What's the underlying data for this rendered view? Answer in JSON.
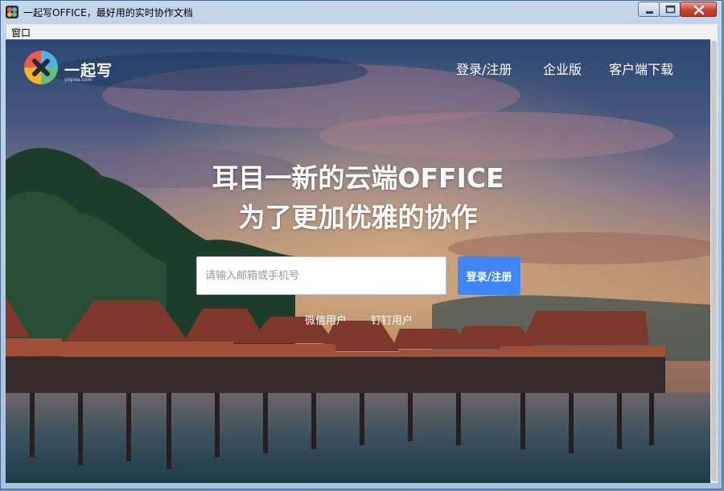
{
  "window": {
    "title": "一起写OFFICE，最好用的实时协作文档",
    "menu": [
      "窗口"
    ]
  },
  "brand": {
    "name": "一起写",
    "domain": "yiqixie.com",
    "colors": {
      "accent": "#3f86f2"
    }
  },
  "nav": {
    "items": [
      {
        "label": "登录/注册"
      },
      {
        "label": "企业版"
      },
      {
        "label": "客户端下载"
      }
    ]
  },
  "hero": {
    "headline_1": "耳目一新的云端OFFICE",
    "headline_2": "为了更加优雅的协作"
  },
  "login": {
    "placeholder": "请输入邮箱或手机号",
    "value": "",
    "button_label": "登录/注册",
    "alt_options": [
      "微信用户",
      "钉钉用户"
    ]
  }
}
